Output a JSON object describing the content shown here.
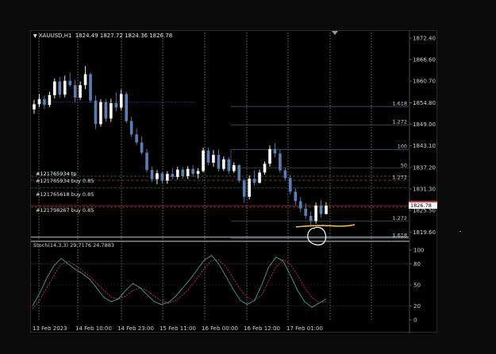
{
  "symbol_header": {
    "symbol": "XAUUSD,H1",
    "ohlc": "1824.49 1827.72 1824.36 1826.78"
  },
  "price_axis": {
    "ticks": [
      "1872.40",
      "1866.60",
      "1860.70",
      "1854.80",
      "1849.00",
      "1843.10",
      "1837.20",
      "1831.30",
      "1825.50",
      "1819.60"
    ],
    "current_price": "1826.78",
    "current_price_color": "#d32f2f"
  },
  "time_axis": {
    "ticks": [
      "13 Feb 2023",
      "14 Feb 10:00",
      "14 Feb 23:00",
      "15 Feb 11:00",
      "16 Feb 00:00",
      "16 Feb 12:00",
      "17 Feb 01:00"
    ]
  },
  "fib_levels": [
    "1.618",
    "1.272",
    "100",
    "50",
    "1.272",
    "1.272",
    "1.618"
  ],
  "orders": {
    "tp_label": "#121765934 tp",
    "order_1": "#121765934 buy 0.85",
    "order_2": "#121765618 buy 0.85",
    "order_3": "#121798267 buy 0.85"
  },
  "stochastic": {
    "label": "Stoch(14,3,3) 29.7176 24.7883",
    "axis_ticks": [
      "100",
      "80",
      "50",
      "20",
      "0"
    ],
    "main_color": "#4a9e8a",
    "signal_color": "#c83a3a"
  },
  "colors": {
    "bull_candle": "#ffffff",
    "bear_candle": "#5b7fb5",
    "annotation": "#f2c230"
  },
  "chart_data": {
    "type": "candlestick",
    "symbol": "XAUUSD",
    "timeframe": "H1",
    "ylim": [
      1817.5,
      1873.5
    ],
    "candles": [
      {
        "o": 1853.0,
        "h": 1855.6,
        "l": 1851.8,
        "c": 1854.4
      },
      {
        "o": 1854.4,
        "h": 1857.2,
        "l": 1853.6,
        "c": 1855.8
      },
      {
        "o": 1855.8,
        "h": 1856.7,
        "l": 1853.1,
        "c": 1854.2
      },
      {
        "o": 1854.2,
        "h": 1857.8,
        "l": 1853.6,
        "c": 1856.9
      },
      {
        "o": 1856.9,
        "h": 1861.4,
        "l": 1856.0,
        "c": 1860.6
      },
      {
        "o": 1860.6,
        "h": 1861.8,
        "l": 1856.2,
        "c": 1857.0
      },
      {
        "o": 1857.0,
        "h": 1862.2,
        "l": 1856.3,
        "c": 1860.8
      },
      {
        "o": 1860.8,
        "h": 1863.1,
        "l": 1859.1,
        "c": 1859.6
      },
      {
        "o": 1859.6,
        "h": 1861.1,
        "l": 1855.0,
        "c": 1856.2
      },
      {
        "o": 1856.2,
        "h": 1860.6,
        "l": 1855.6,
        "c": 1859.6
      },
      {
        "o": 1859.6,
        "h": 1864.8,
        "l": 1858.5,
        "c": 1862.6
      },
      {
        "o": 1862.6,
        "h": 1863.0,
        "l": 1854.8,
        "c": 1855.4
      },
      {
        "o": 1855.4,
        "h": 1856.8,
        "l": 1847.6,
        "c": 1849.0
      },
      {
        "o": 1849.0,
        "h": 1855.8,
        "l": 1848.3,
        "c": 1855.0
      },
      {
        "o": 1855.0,
        "h": 1855.8,
        "l": 1849.6,
        "c": 1850.5
      },
      {
        "o": 1850.5,
        "h": 1855.9,
        "l": 1849.6,
        "c": 1854.7
      },
      {
        "o": 1854.7,
        "h": 1857.6,
        "l": 1852.4,
        "c": 1853.5
      },
      {
        "o": 1853.5,
        "h": 1858.4,
        "l": 1852.8,
        "c": 1857.2
      },
      {
        "o": 1857.2,
        "h": 1857.8,
        "l": 1849.2,
        "c": 1849.8
      },
      {
        "o": 1849.8,
        "h": 1851.0,
        "l": 1845.5,
        "c": 1846.2
      },
      {
        "o": 1846.2,
        "h": 1847.8,
        "l": 1843.4,
        "c": 1844.0
      },
      {
        "o": 1844.0,
        "h": 1845.6,
        "l": 1840.7,
        "c": 1841.2
      },
      {
        "o": 1841.2,
        "h": 1842.2,
        "l": 1835.8,
        "c": 1836.5
      },
      {
        "o": 1836.5,
        "h": 1837.4,
        "l": 1833.2,
        "c": 1834.0
      },
      {
        "o": 1834.0,
        "h": 1836.5,
        "l": 1832.6,
        "c": 1835.6
      },
      {
        "o": 1835.6,
        "h": 1836.0,
        "l": 1832.8,
        "c": 1833.6
      },
      {
        "o": 1833.6,
        "h": 1836.2,
        "l": 1832.7,
        "c": 1835.4
      },
      {
        "o": 1835.4,
        "h": 1837.0,
        "l": 1833.8,
        "c": 1834.6
      },
      {
        "o": 1834.6,
        "h": 1837.4,
        "l": 1833.9,
        "c": 1836.6
      },
      {
        "o": 1836.6,
        "h": 1837.3,
        "l": 1834.1,
        "c": 1834.8
      },
      {
        "o": 1834.8,
        "h": 1837.5,
        "l": 1834.0,
        "c": 1836.8
      },
      {
        "o": 1836.8,
        "h": 1837.8,
        "l": 1834.6,
        "c": 1835.4
      },
      {
        "o": 1835.4,
        "h": 1837.0,
        "l": 1834.2,
        "c": 1836.2
      },
      {
        "o": 1836.2,
        "h": 1842.6,
        "l": 1835.8,
        "c": 1841.8
      },
      {
        "o": 1841.8,
        "h": 1842.6,
        "l": 1837.8,
        "c": 1838.5
      },
      {
        "o": 1838.5,
        "h": 1841.9,
        "l": 1837.4,
        "c": 1840.6
      },
      {
        "o": 1840.6,
        "h": 1842.1,
        "l": 1836.1,
        "c": 1836.8
      },
      {
        "o": 1836.8,
        "h": 1840.2,
        "l": 1836.2,
        "c": 1839.4
      },
      {
        "o": 1839.4,
        "h": 1840.0,
        "l": 1835.4,
        "c": 1836.2
      },
      {
        "o": 1836.2,
        "h": 1838.6,
        "l": 1835.7,
        "c": 1837.8
      },
      {
        "o": 1837.8,
        "h": 1838.1,
        "l": 1833.0,
        "c": 1833.6
      },
      {
        "o": 1833.6,
        "h": 1834.2,
        "l": 1827.6,
        "c": 1829.2
      },
      {
        "o": 1829.2,
        "h": 1835.0,
        "l": 1828.5,
        "c": 1834.1
      },
      {
        "o": 1834.1,
        "h": 1836.4,
        "l": 1832.2,
        "c": 1833.0
      },
      {
        "o": 1833.0,
        "h": 1836.6,
        "l": 1832.8,
        "c": 1835.8
      },
      {
        "o": 1835.8,
        "h": 1838.8,
        "l": 1835.2,
        "c": 1838.2
      },
      {
        "o": 1838.2,
        "h": 1843.2,
        "l": 1837.4,
        "c": 1842.2
      },
      {
        "o": 1842.2,
        "h": 1843.8,
        "l": 1840.0,
        "c": 1841.0
      },
      {
        "o": 1841.0,
        "h": 1842.0,
        "l": 1835.6,
        "c": 1836.4
      },
      {
        "o": 1836.4,
        "h": 1837.1,
        "l": 1833.6,
        "c": 1834.3
      },
      {
        "o": 1834.3,
        "h": 1835.1,
        "l": 1829.8,
        "c": 1830.6
      },
      {
        "o": 1830.6,
        "h": 1831.6,
        "l": 1826.9,
        "c": 1828.0
      },
      {
        "o": 1828.0,
        "h": 1829.2,
        "l": 1825.0,
        "c": 1826.0
      },
      {
        "o": 1826.0,
        "h": 1827.4,
        "l": 1823.2,
        "c": 1824.0
      },
      {
        "o": 1824.0,
        "h": 1825.2,
        "l": 1821.4,
        "c": 1822.6
      },
      {
        "o": 1822.6,
        "h": 1827.6,
        "l": 1821.9,
        "c": 1826.8
      },
      {
        "o": 1826.8,
        "h": 1828.4,
        "l": 1823.6,
        "c": 1824.5
      },
      {
        "o": 1824.49,
        "h": 1827.72,
        "l": 1824.36,
        "c": 1826.78
      }
    ],
    "stoch_main": [
      20,
      38,
      60,
      78,
      88,
      80,
      72,
      66,
      58,
      45,
      32,
      26,
      30,
      42,
      52,
      46,
      36,
      26,
      22,
      25,
      34,
      46,
      58,
      72,
      86,
      92,
      80,
      62,
      44,
      28,
      22,
      28,
      50,
      76,
      90,
      84,
      64,
      42,
      26,
      18,
      24,
      30
    ],
    "stoch_signal": [
      16,
      28,
      46,
      64,
      80,
      84,
      78,
      70,
      62,
      52,
      42,
      32,
      30,
      34,
      42,
      46,
      42,
      34,
      27,
      24,
      28,
      36,
      46,
      60,
      74,
      85,
      86,
      76,
      60,
      44,
      32,
      28,
      36,
      56,
      76,
      86,
      80,
      64,
      46,
      32,
      25,
      26
    ]
  }
}
